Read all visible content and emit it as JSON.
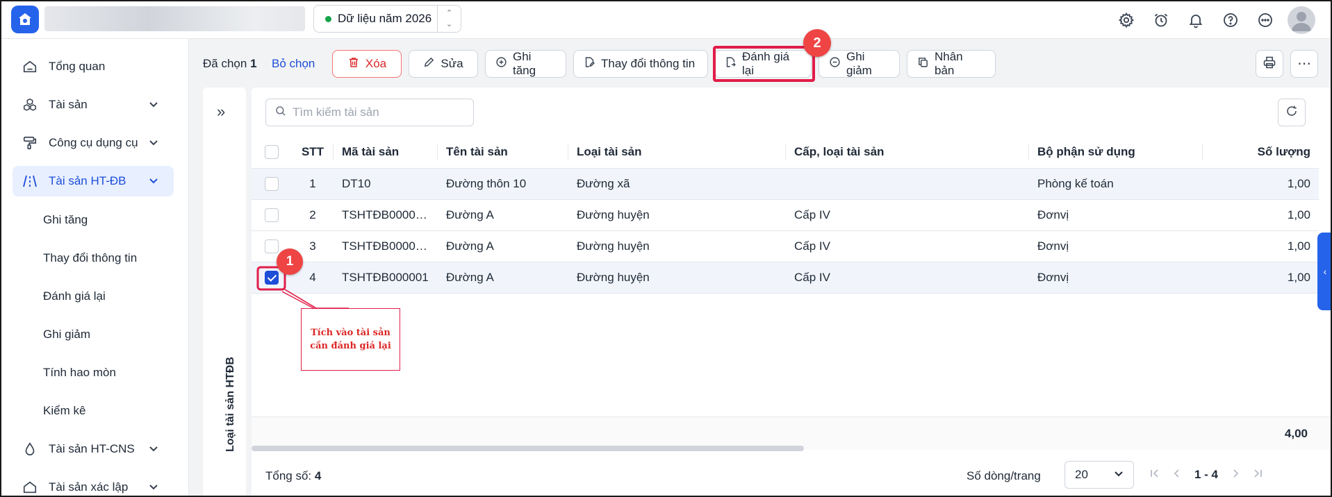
{
  "header": {
    "year_label": "Dữ liệu năm 2026"
  },
  "sidebar": {
    "items": [
      {
        "label": "Tổng quan"
      },
      {
        "label": "Tài sản"
      },
      {
        "label": "Công cụ dụng cụ"
      },
      {
        "label": "Tài sản HT-ĐB"
      },
      {
        "label": "Tài sản HT-CNS"
      },
      {
        "label": "Tài sản xác lập"
      }
    ],
    "subitems": [
      "Ghi tăng",
      "Thay đổi thông tin",
      "Đánh giá lại",
      "Ghi giảm",
      "Tính hao mòn",
      "Kiểm kê"
    ]
  },
  "toolbar": {
    "selected_label": "Đã chọn",
    "selected_count": "1",
    "unselect_label": "Bỏ chọn",
    "delete_label": "Xóa",
    "edit_label": "Sửa",
    "increase_label": "Ghi tăng",
    "change_info_label": "Thay đổi thông tin",
    "revalue_label": "Đánh giá lại",
    "decrease_label": "Ghi giảm",
    "duplicate_label": "Nhân bản"
  },
  "category_panel": {
    "label": "Loại tài sản HTĐB"
  },
  "grid": {
    "search_placeholder": "Tìm kiếm tài sản",
    "columns": [
      "STT",
      "Mã tài sản",
      "Tên tài sản",
      "Loại tài sản",
      "Cấp, loại tài sản",
      "Bộ phận sử dụng",
      "Số lượng"
    ],
    "rows": [
      {
        "stt": "1",
        "code": "DT10",
        "name": "Đường thôn 10",
        "type": "Đường xã",
        "level": "",
        "dept": "Phòng kế toán",
        "qty": "1,00",
        "checked": false
      },
      {
        "stt": "2",
        "code": "TSHTĐB00000...",
        "name": "Đường A",
        "type": "Đường huyện",
        "level": "Cấp IV",
        "dept": "Đơnvị",
        "qty": "1,00",
        "checked": false
      },
      {
        "stt": "3",
        "code": "TSHTĐB00000...",
        "name": "Đường A",
        "type": "Đường huyện",
        "level": "Cấp IV",
        "dept": "Đơnvị",
        "qty": "1,00",
        "checked": false
      },
      {
        "stt": "4",
        "code": "TSHTĐB000001",
        "name": "Đường A",
        "type": "Đường huyện",
        "level": "Cấp IV",
        "dept": "Đơnvị",
        "qty": "1,00",
        "checked": true
      }
    ],
    "total_qty": "4,00"
  },
  "footer": {
    "total_label": "Tổng số:",
    "total_value": "4",
    "rows_per_page_label": "Số dòng/trang",
    "rows_per_page_value": "20",
    "range": "1 - 4"
  },
  "annotations": {
    "badge1": "1",
    "badge2": "2",
    "callout_line1": "Tích vào tài sản",
    "callout_line2": "cần đánh giá lại"
  },
  "colors": {
    "primary": "#2563eb",
    "danger": "#dc2626",
    "highlight": "#e11d48"
  }
}
